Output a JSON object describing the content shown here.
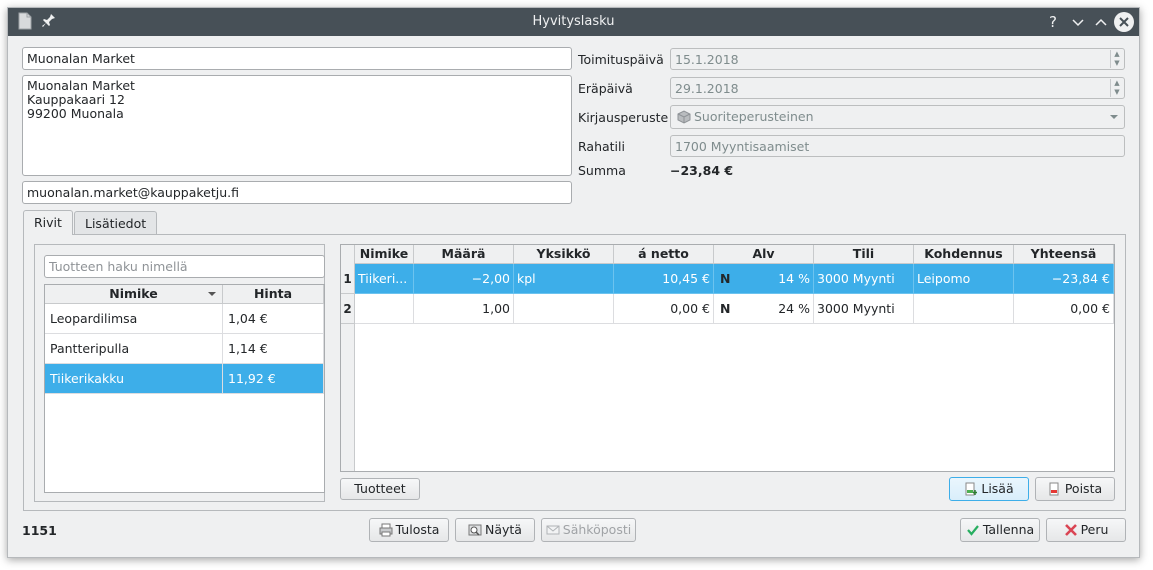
{
  "window": {
    "title": "Hyvityslasku",
    "help_glyph": "?",
    "minimize_glyph": "⌄",
    "maximize_glyph": "⌃",
    "close_glyph": "✕"
  },
  "customer": {
    "name": "Muonalan Market",
    "address_lines": [
      "Muonalan Market",
      "Kauppakaari 12",
      "99200 Muonala"
    ],
    "email": "muonalan.market@kauppaketju.fi"
  },
  "fields": {
    "delivery_date_label": "Toimituspäivä",
    "delivery_date_value": "15.1.2018",
    "due_date_label": "Eräpäivä",
    "due_date_value": "29.1.2018",
    "booking_basis_label": "Kirjausperuste",
    "booking_basis_value": "Suoriteperusteinen",
    "account_label": "Rahatili",
    "account_value": "1700 Myyntisaamiset",
    "sum_label": "Summa",
    "sum_value": "−23,84 €"
  },
  "tabs": [
    {
      "label": "Rivit",
      "active": true
    },
    {
      "label": "Lisätiedot",
      "active": false
    }
  ],
  "products": {
    "search_placeholder": "Tuotteen haku nimellä",
    "headers": [
      "Nimike",
      "Hinta"
    ],
    "rows": [
      {
        "name": "Leopardilimsa",
        "price": "1,04 €",
        "selected": false
      },
      {
        "name": "Pantteripulla",
        "price": "1,14 €",
        "selected": false
      },
      {
        "name": "Tiikerikakku",
        "price": "11,92 €",
        "selected": true
      }
    ]
  },
  "lines": {
    "headers": [
      "Nimike",
      "Määrä",
      "Yksikkö",
      "á netto",
      "Alv",
      "Tili",
      "Kohdennus",
      "Yhteensä"
    ],
    "rows": [
      {
        "num": "1",
        "name": "Tiikeri...",
        "qty": "−2,00",
        "unit": "kpl",
        "net": "10,45 €",
        "vat_code": "N",
        "vat": "14 %",
        "account": "3000 Myynti",
        "target": "Leipomo",
        "total": "−23,84 €",
        "selected": true
      },
      {
        "num": "2",
        "name": "",
        "qty": "1,00",
        "unit": "",
        "net": "0,00 €",
        "vat_code": "N",
        "vat": "24 %",
        "account": "3000 Myynti",
        "target": "",
        "total": "0,00 €",
        "selected": false
      }
    ]
  },
  "buttons": {
    "products": "Tuotteet",
    "add": "Lisää",
    "remove": "Poista",
    "print": "Tulosta",
    "show": "Näytä",
    "email": "Sähköposti",
    "save": "Tallenna",
    "cancel": "Peru"
  },
  "footer": {
    "invoice_number": "1151"
  },
  "colors": {
    "selection": "#3daee9",
    "titlebar": "#475057",
    "window_bg": "#eff0f1"
  }
}
